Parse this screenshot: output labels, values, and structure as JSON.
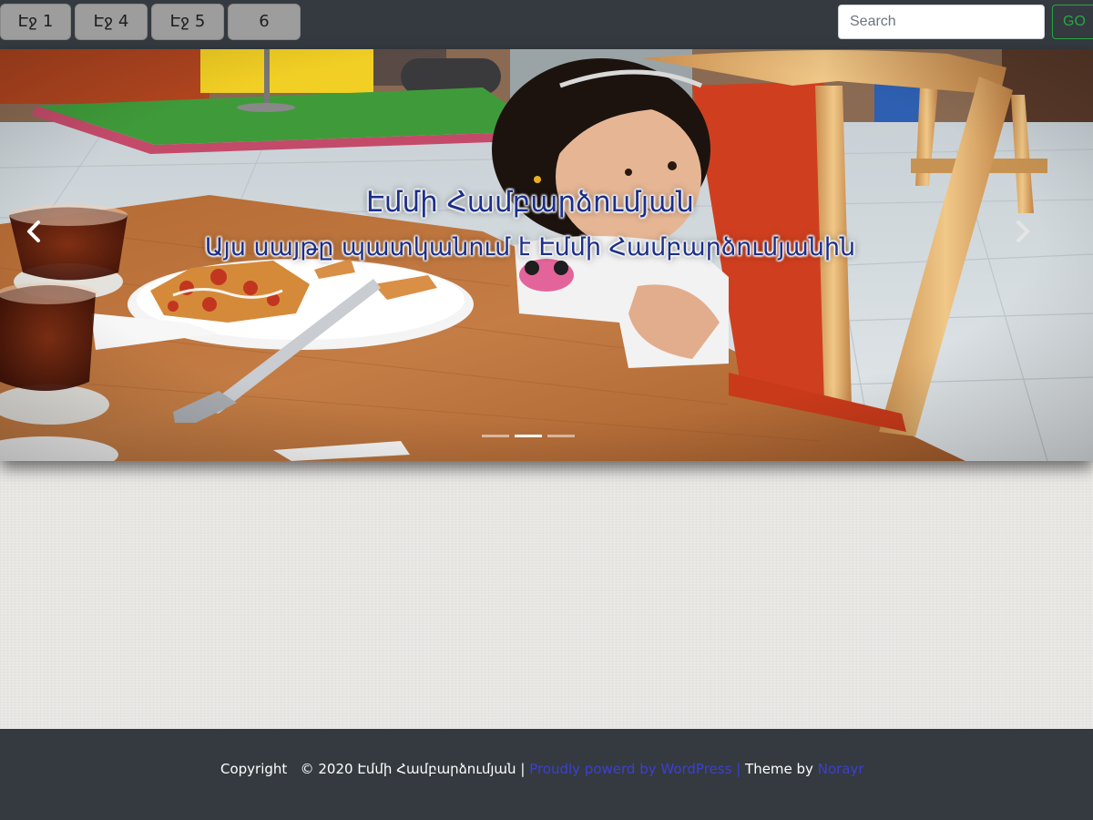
{
  "nav": {
    "tabs": [
      {
        "label": "Էջ 1"
      },
      {
        "label": "Էջ 4"
      },
      {
        "label": "Էջ 5"
      },
      {
        "label": "6"
      }
    ],
    "search": {
      "placeholder": "Search",
      "button_label": "GO"
    }
  },
  "carousel": {
    "title": "Էմմի Համբարձումյան",
    "subtitle": "Այս սայթը պատկանում է Էմմի Համբարձումյանին",
    "prev_icon": "chevron-left-icon",
    "next_icon": "chevron-right-icon",
    "slide_count": 3,
    "active_slide_index": 1
  },
  "footer": {
    "copyright_label": "Copyright",
    "copyright_text": "© 2020 Էմմի Համբարձումյան",
    "separator": "|",
    "wordpress_link": "Proudly powerd by WordPress",
    "separator2": "|",
    "theme_label": "Theme by",
    "theme_author": "Norayr"
  },
  "colors": {
    "nav_background": "#343a40",
    "tab_background": "#9d9d9d",
    "go_button": "#28a745",
    "caption_text": "#1b2f8a",
    "footer_link": "#3d3fd1",
    "footer_background": "#343a40"
  }
}
